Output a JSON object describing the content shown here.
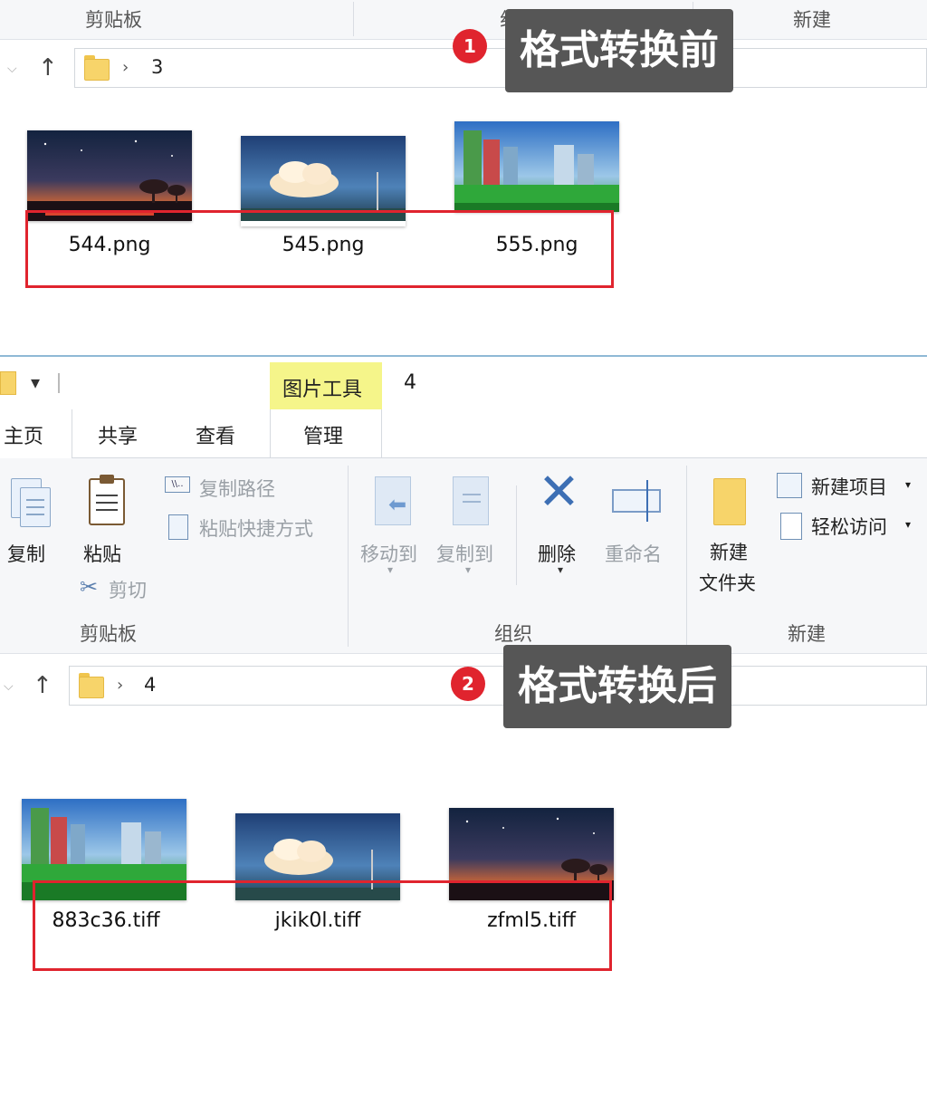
{
  "top": {
    "ribbon_groups": [
      "剪贴板",
      "组织",
      "新建"
    ],
    "address_path": "3",
    "callout_number": "1",
    "callout_text": "格式转换前",
    "files": [
      {
        "name": "544.png",
        "scene": "dusk-trees"
      },
      {
        "name": "545.png",
        "scene": "clouds-sky"
      },
      {
        "name": "555.png",
        "scene": "green-city"
      }
    ]
  },
  "bottom": {
    "qat_dropdown": "▾",
    "context_tab_label": "图片工具",
    "window_title": "4",
    "tabs": [
      "主页",
      "共享",
      "查看",
      "管理"
    ],
    "ribbon": {
      "copy": "复制",
      "paste": "粘贴",
      "copy_path": "复制路径",
      "paste_shortcut": "粘贴快捷方式",
      "cut": "剪切",
      "move_to": "移动到",
      "copy_to": "复制到",
      "delete": "删除",
      "rename": "重命名",
      "new_folder_line1": "新建",
      "new_folder_line2": "文件夹",
      "new_item": "新建项目",
      "easy_access": "轻松访问",
      "group_clipboard": "剪贴板",
      "group_organize": "组织",
      "group_new": "新建"
    },
    "address_path": "4",
    "callout_number": "2",
    "callout_text": "格式转换后",
    "files": [
      {
        "name": "883c36.tiff",
        "scene": "green-city"
      },
      {
        "name": "jkik0l.tiff",
        "scene": "clouds-sky"
      },
      {
        "name": "zfml5.tiff",
        "scene": "dusk-trees"
      }
    ]
  },
  "colors": {
    "highlight_red": "#e0242e",
    "callout_bg": "#565656",
    "context_tab_yellow": "#f5f58a",
    "folder_yellow": "#f7d46a"
  }
}
